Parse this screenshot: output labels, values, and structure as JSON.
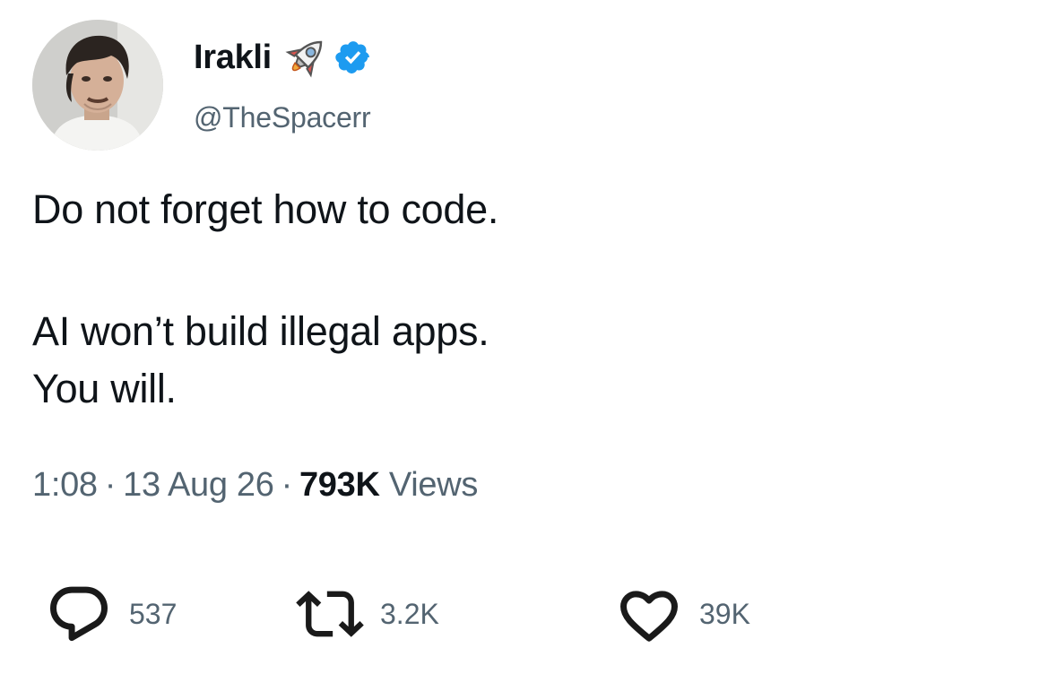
{
  "author": {
    "display_name": "Irakli",
    "handle": "@TheSpacerr",
    "name_emoji": "rocket-icon",
    "verified_badge": "verified-icon"
  },
  "tweet": {
    "lines": [
      "Do not forget how to code.",
      "AI won’t build illegal apps.",
      "You will."
    ]
  },
  "meta": {
    "time": "1:08",
    "date": "13 Aug 26",
    "separator": "·",
    "views_count": "793K",
    "views_label": "Views"
  },
  "actions": {
    "reply": {
      "icon": "reply-icon",
      "count": "537"
    },
    "repost": {
      "icon": "repost-icon",
      "count": "3.2K"
    },
    "like": {
      "icon": "heart-icon",
      "count": "39K"
    }
  },
  "colors": {
    "text": "#0f1419",
    "secondary": "#536471",
    "verified": "#1d9bf0",
    "background": "#ffffff"
  }
}
